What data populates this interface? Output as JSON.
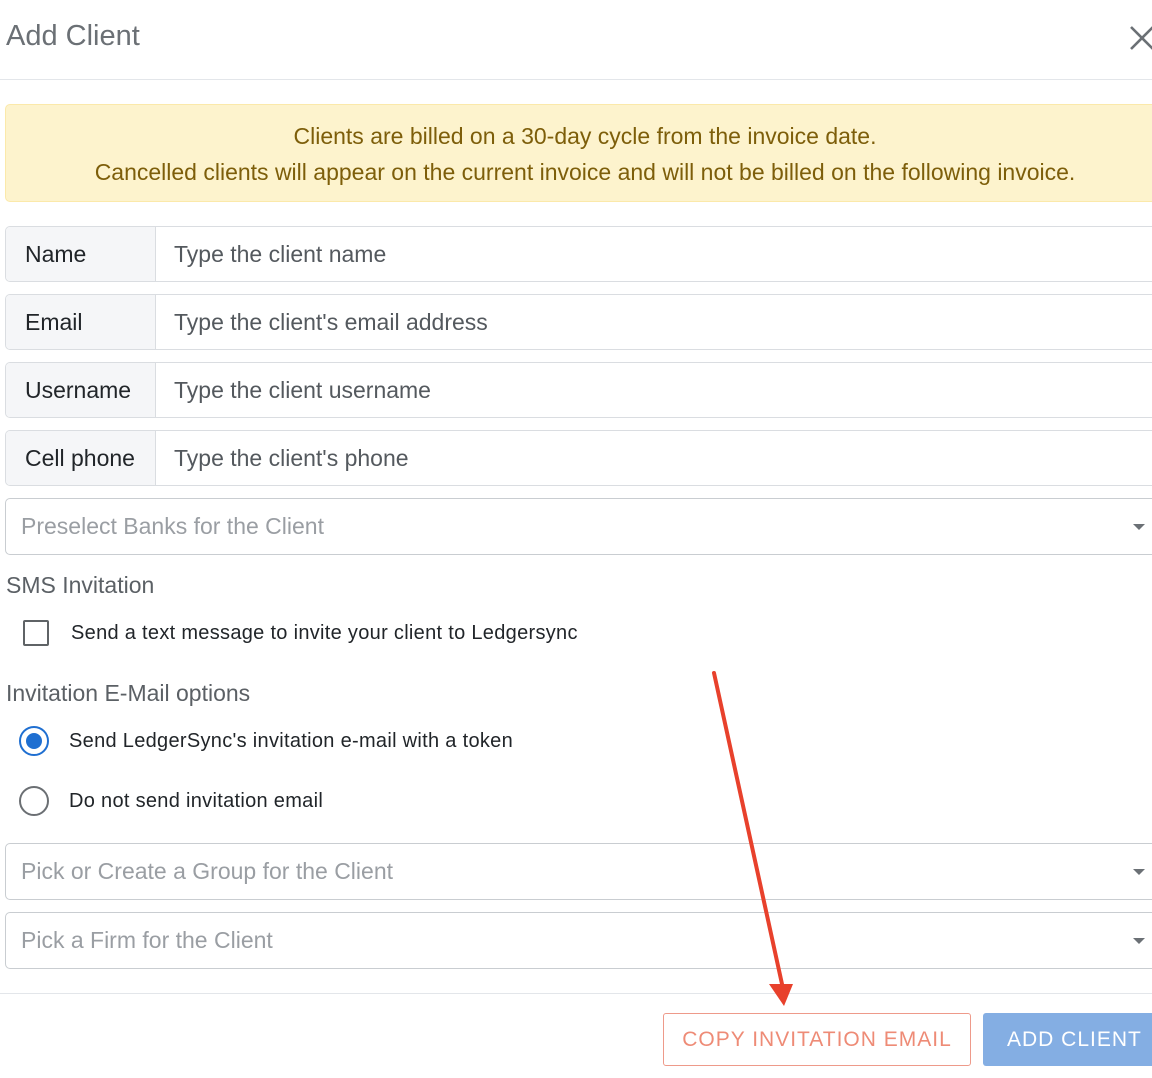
{
  "modal": {
    "title": "Add Client",
    "close_icon": "close-icon"
  },
  "alert": {
    "line1": "Clients are billed on a 30-day cycle from the invoice date.",
    "line2": "Cancelled clients will appear on the current invoice and will not be billed on the following invoice.",
    "background_color": "#fdf3cd",
    "text_color": "#7d5e0a"
  },
  "fields": {
    "name": {
      "label": "Name",
      "placeholder": "Type the client name",
      "value": ""
    },
    "email": {
      "label": "Email",
      "placeholder": "Type the client's email address",
      "value": ""
    },
    "username": {
      "label": "Username",
      "placeholder": "Type the client username",
      "value": ""
    },
    "cell_phone": {
      "label": "Cell phone",
      "placeholder": "Type the client's phone",
      "value": ""
    }
  },
  "selects": {
    "banks": {
      "placeholder": "Preselect Banks for the Client"
    },
    "group": {
      "placeholder": "Pick or Create a Group for the Client"
    },
    "firm": {
      "placeholder": "Pick a Firm for the Client"
    }
  },
  "sms": {
    "heading": "SMS Invitation",
    "checkbox_label": "Send a text message to invite your client to Ledgersync",
    "checked": false
  },
  "email_options": {
    "heading": "Invitation E-Mail options",
    "options": [
      {
        "label": "Send LedgerSync's invitation e-mail with a token",
        "selected": true
      },
      {
        "label": "Do not send invitation email",
        "selected": false
      }
    ]
  },
  "footer": {
    "copy_button": "COPY INVITATION EMAIL",
    "add_button": "ADD CLIENT"
  },
  "colors": {
    "accent": "#1f6fd1",
    "primary_button": "#84aee3",
    "outline_button": "#ee8b76",
    "annotation_arrow": "#e8412c"
  }
}
